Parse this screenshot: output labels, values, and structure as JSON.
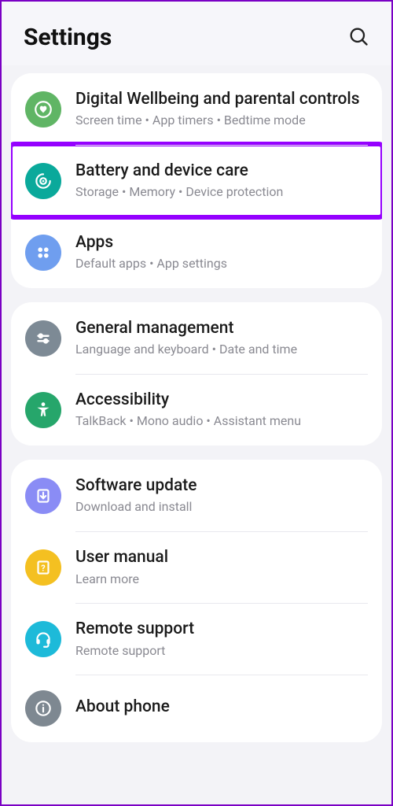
{
  "header": {
    "title": "Settings"
  },
  "groups": [
    {
      "items": [
        {
          "title": "Digital Wellbeing and parental controls",
          "subtitle": "Screen time  •  App timers  •  Bedtime mode"
        },
        {
          "title": "Battery and device care",
          "subtitle": "Storage  •  Memory  •  Device protection"
        },
        {
          "title": "Apps",
          "subtitle": "Default apps  •  App settings"
        }
      ]
    },
    {
      "items": [
        {
          "title": "General management",
          "subtitle": "Language and keyboard  •  Date and time"
        },
        {
          "title": "Accessibility",
          "subtitle": "TalkBack  •  Mono audio  •  Assistant menu"
        }
      ]
    },
    {
      "items": [
        {
          "title": "Software update",
          "subtitle": "Download and install"
        },
        {
          "title": "User manual",
          "subtitle": "Learn more"
        },
        {
          "title": "Remote support",
          "subtitle": "Remote support"
        },
        {
          "title": "About phone",
          "subtitle": ""
        }
      ]
    }
  ]
}
